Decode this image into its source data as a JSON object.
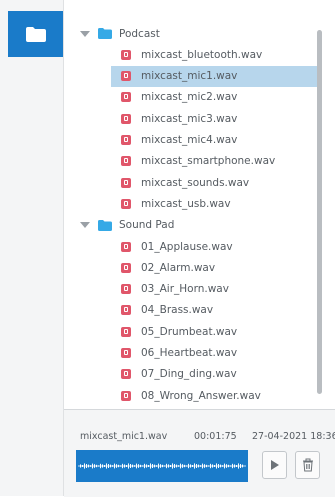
{
  "sidebar": {
    "button_icon": "folder-icon",
    "accent": "#1a7bc9"
  },
  "tree": {
    "groups": [
      {
        "name": "Podcast",
        "files": [
          "mixcast_bluetooth.wav",
          "mixcast_mic1.wav",
          "mixcast_mic2.wav",
          "mixcast_mic3.wav",
          "mixcast_mic4.wav",
          "mixcast_smartphone.wav",
          "mixcast_sounds.wav",
          "mixcast_usb.wav"
        ]
      },
      {
        "name": "Sound Pad",
        "files": [
          "01_Applause.wav",
          "02_Alarm.wav",
          "03_Air_Horn.wav",
          "04_Brass.wav",
          "05_Drumbeat.wav",
          "06_Heartbeat.wav",
          "07_Ding_ding.wav",
          "08_Wrong_Answer.wav"
        ]
      }
    ],
    "selected_file": "mixcast_mic1.wav"
  },
  "player": {
    "filename": "mixcast_mic1.wav",
    "duration": "00:01:75",
    "date": "27-04-2021 18:36",
    "play_icon": "play-icon",
    "delete_icon": "trash-icon"
  },
  "colors": {
    "selected_row": "#b7d6ec",
    "wav_icon": "#e0566a",
    "folder": "#35a9e6"
  }
}
